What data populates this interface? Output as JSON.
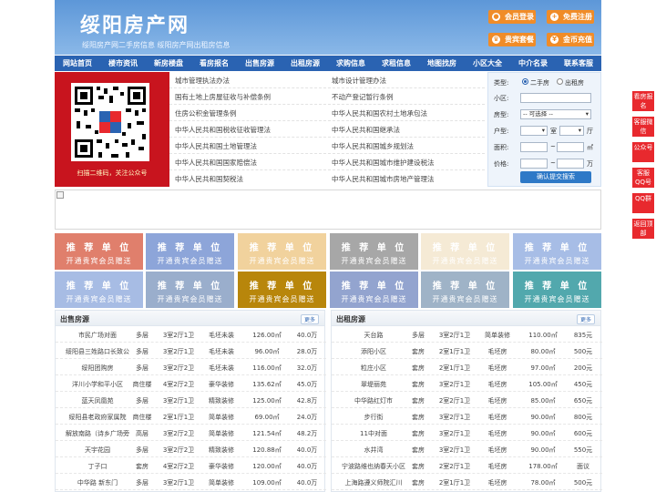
{
  "header": {
    "logo": "绥阳房产网",
    "tagline": "绥阳房产网二手房信息   绥阳房产网出租房信息",
    "buttons": [
      {
        "label": "会员登录",
        "icon": "user-icon"
      },
      {
        "label": "免费注册",
        "icon": "plus-icon"
      },
      {
        "label": "贵宾套餐",
        "icon": "crown-icon"
      },
      {
        "label": "金币充值",
        "icon": "coin-icon"
      }
    ]
  },
  "nav": [
    "网站首页",
    "楼市资讯",
    "新房楼盘",
    "看房报名",
    "出售房源",
    "出租房源",
    "求购信息",
    "求租信息",
    "地图找房",
    "小区大全",
    "中介名录",
    "联系客服"
  ],
  "qr": {
    "caption": "扫描二维码，关注公众号"
  },
  "links": {
    "left": [
      "城市管理执法办法",
      "国有土地上房屋征收与补偿条例",
      "住房公积金管理条例",
      "中华人民共和国税收征收管理法",
      "中华人民共和国土地管理法",
      "中华人民共和国国家赔偿法",
      "中华人民共和国契税法"
    ],
    "right": [
      "城市设计管理办法",
      "不动产登记暂行条例",
      "中华人民共和国农村土地承包法",
      "中华人民共和国继承法",
      "中华人民共和国城乡规划法",
      "中华人民共和国城市维护建设税法",
      "中华人民共和国城市房地产管理法"
    ]
  },
  "search": {
    "type_label": "类型:",
    "type_options": [
      "二手房",
      "出租房"
    ],
    "community_label": "小区:",
    "layout_label": "房型:",
    "layout_select": "-- 可选择 --",
    "room_label": "户型:",
    "room_unit": "室",
    "hall_unit": "厅",
    "area_label": "面积:",
    "area_unit": "㎡",
    "price_label": "价格:",
    "price_unit": "万",
    "submit": "确认提交搜索"
  },
  "ads": {
    "line1": "推 荐 单 位",
    "line2": "开通贵宾会员赠送",
    "colors": [
      "#e07f6c",
      "#8da5d9",
      "#f1d29d",
      "#a7a7a7",
      "#f5ead5",
      "#a7bde6",
      "#a7bce4",
      "#9aaecc",
      "#b8860b",
      "#93a4cf",
      "#9fb3c7",
      "#52a8ad"
    ]
  },
  "sale": {
    "title": "出售房源",
    "more": "更多",
    "rows": [
      [
        "市民广场对面",
        "多层",
        "3室2厅1卫",
        "毛坯未装",
        "126.00㎡",
        "40.0万"
      ],
      [
        "绥阳县三姓路口长致公",
        "多层",
        "3室2厅1卫",
        "毛坯未装",
        "96.00㎡",
        "28.0万"
      ],
      [
        "绥阳团购房",
        "多层",
        "3室2厅2卫",
        "毛坯未装",
        "116.00㎡",
        "32.0万"
      ],
      [
        "洋川小学和平小区",
        "商住楼",
        "4室2厅2卫",
        "豪华装修",
        "135.62㎡",
        "45.0万"
      ],
      [
        "蓝天凤凰苑",
        "多层",
        "3室2厅1卫",
        "精致装修",
        "125.00㎡",
        "42.8万"
      ],
      [
        "绥阳县老政府家属院",
        "商住楼",
        "2室1厅1卫",
        "简单装修",
        "69.00㎡",
        "24.0万"
      ],
      [
        "解放南路（诗乡广场旁",
        "高层",
        "3室2厅2卫",
        "简单装修",
        "121.54㎡",
        "48.2万"
      ],
      [
        "天宇花园",
        "多层",
        "3室2厅2卫",
        "精致装修",
        "120.88㎡",
        "40.0万"
      ],
      [
        "丁子口",
        "套房",
        "4室2厅2卫",
        "豪华装修",
        "120.00㎡",
        "40.0万"
      ],
      [
        "中华路 新东门",
        "多层",
        "3室2厅1卫",
        "简单装修",
        "109.00㎡",
        "40.0万"
      ]
    ]
  },
  "rent": {
    "title": "出租房源",
    "more": "更多",
    "rows": [
      [
        "天台路",
        "多层",
        "3室2厅1卫",
        "简单装修",
        "110.00㎡",
        "835元"
      ],
      [
        "添阳小区",
        "套房",
        "2室1厅1卫",
        "毛坯房",
        "80.00㎡",
        "500元"
      ],
      [
        "粒庄小区",
        "套房",
        "2室1厅1卫",
        "毛坯房",
        "97.00㎡",
        "200元"
      ],
      [
        "翠堤丽苑",
        "套房",
        "3室2厅1卫",
        "毛坯房",
        "105.00㎡",
        "450元"
      ],
      [
        "中华路红灯市",
        "套房",
        "2室2厅1卫",
        "毛坯房",
        "85.00㎡",
        "650元"
      ],
      [
        "步行街",
        "套房",
        "3室2厅1卫",
        "毛坯房",
        "90.00㎡",
        "800元"
      ],
      [
        "11中对面",
        "套房",
        "3室2厅1卫",
        "毛坯房",
        "90.00㎡",
        "600元"
      ],
      [
        "水井湾",
        "套房",
        "3室2厅1卫",
        "毛坯房",
        "90.00㎡",
        "550元"
      ],
      [
        "宁波路维也纳春天小区",
        "套房",
        "2室2厅1卫",
        "毛坯房",
        "178.00㎡",
        "面议"
      ],
      [
        "上海路遵义师院汇川",
        "套房",
        "2室1厅1卫",
        "毛坯房",
        "78.00㎡",
        "500元"
      ]
    ]
  },
  "side": [
    "看房报名",
    "客服微信",
    "公众号",
    "客服QQ号",
    "QQ群",
    "返回顶部"
  ]
}
